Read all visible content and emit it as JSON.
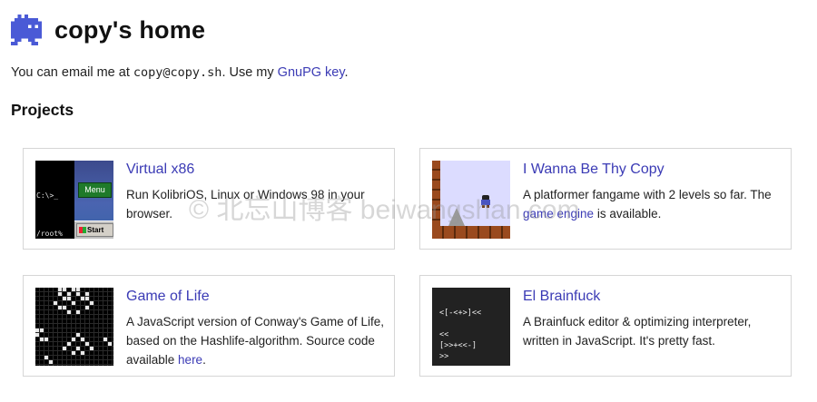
{
  "header": {
    "title": "copy's home",
    "logo_icon": "pixel-creature-logo-icon"
  },
  "intro": {
    "text_before_email": "You can email me at ",
    "email": "copy@copy.sh",
    "text_after_email": ". Use my ",
    "gpg_link": "GnuPG key",
    "text_end": "."
  },
  "projects": {
    "heading": "Projects",
    "items": [
      {
        "title": "Virtual x86",
        "description": "Run KolibriOS, Linux or Windows 98 in your browser.",
        "thumb": {
          "prompt_top": "C:\\>_",
          "prompt_bottom": "/root%",
          "menu": "Menu",
          "start": "Start"
        }
      },
      {
        "title": "I Wanna Be Thy Copy",
        "desc_before_link": "A platformer fangame with 2 levels so far. The ",
        "link": "game engine",
        "desc_after_link": " is available."
      },
      {
        "title": "Game of Life",
        "desc_before_link": "A JavaScript version of Conway's Game of Life, based on the Hashlife-algorithm. Source code available ",
        "link": "here",
        "desc_after_link": "."
      },
      {
        "title": "El Brainfuck",
        "description": "A Brainfuck editor & optimizing interpreter, written in JavaScript. It's pretty fast.",
        "thumb": {
          "code_lines": [
            "<[-<+>]<<",
            "",
            "<<",
            "[>>+<<-]",
            ">>"
          ]
        }
      }
    ]
  },
  "watermark": "© 北忘山博客 beiwangshan.com",
  "colors": {
    "link": "#3b3bb5",
    "logo": "#4a5ad6",
    "card_border": "#d6d6d6"
  }
}
